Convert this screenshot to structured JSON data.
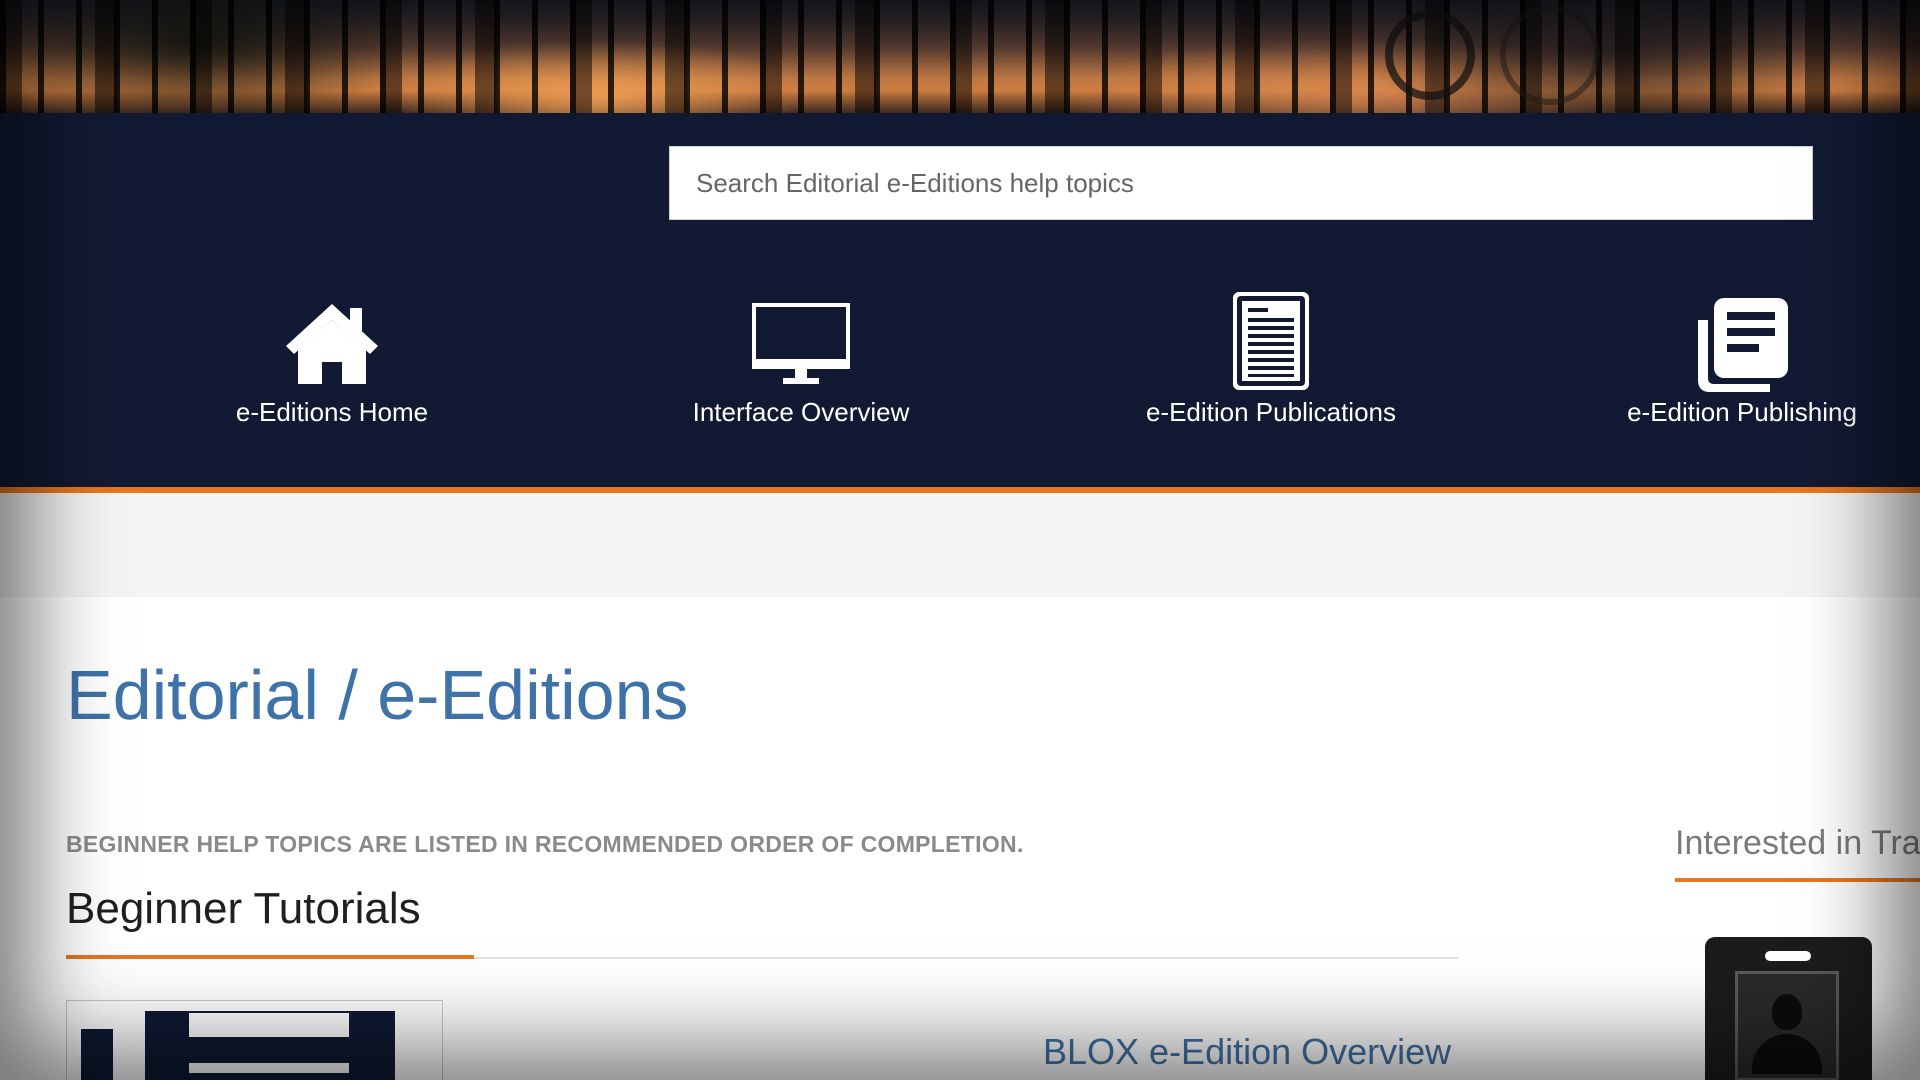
{
  "search": {
    "placeholder": "Search Editorial e-Editions help topics"
  },
  "nav": {
    "items": [
      {
        "label": "e-Editions Home",
        "icon": "home-icon"
      },
      {
        "label": "Interface Overview",
        "icon": "monitor-icon"
      },
      {
        "label": "e-Edition Publications",
        "icon": "document-icon"
      },
      {
        "label": "e-Edition Publishing",
        "icon": "newspaper-icon"
      }
    ]
  },
  "main": {
    "title": "Editorial / e-Editions",
    "note": "BEGINNER HELP TOPICS ARE LISTED IN RECOMMENDED ORDER OF COMPLETION.",
    "section_title": "Beginner Tutorials",
    "articles": [
      {
        "title": "BLOX e-Edition Overview"
      }
    ]
  },
  "sidebar": {
    "title": "Interested in Tra",
    "badge_icon": "id-badge-icon"
  },
  "colors": {
    "header_bg": "#121a33",
    "accent": "#e8771f",
    "link": "#3f72a8"
  }
}
